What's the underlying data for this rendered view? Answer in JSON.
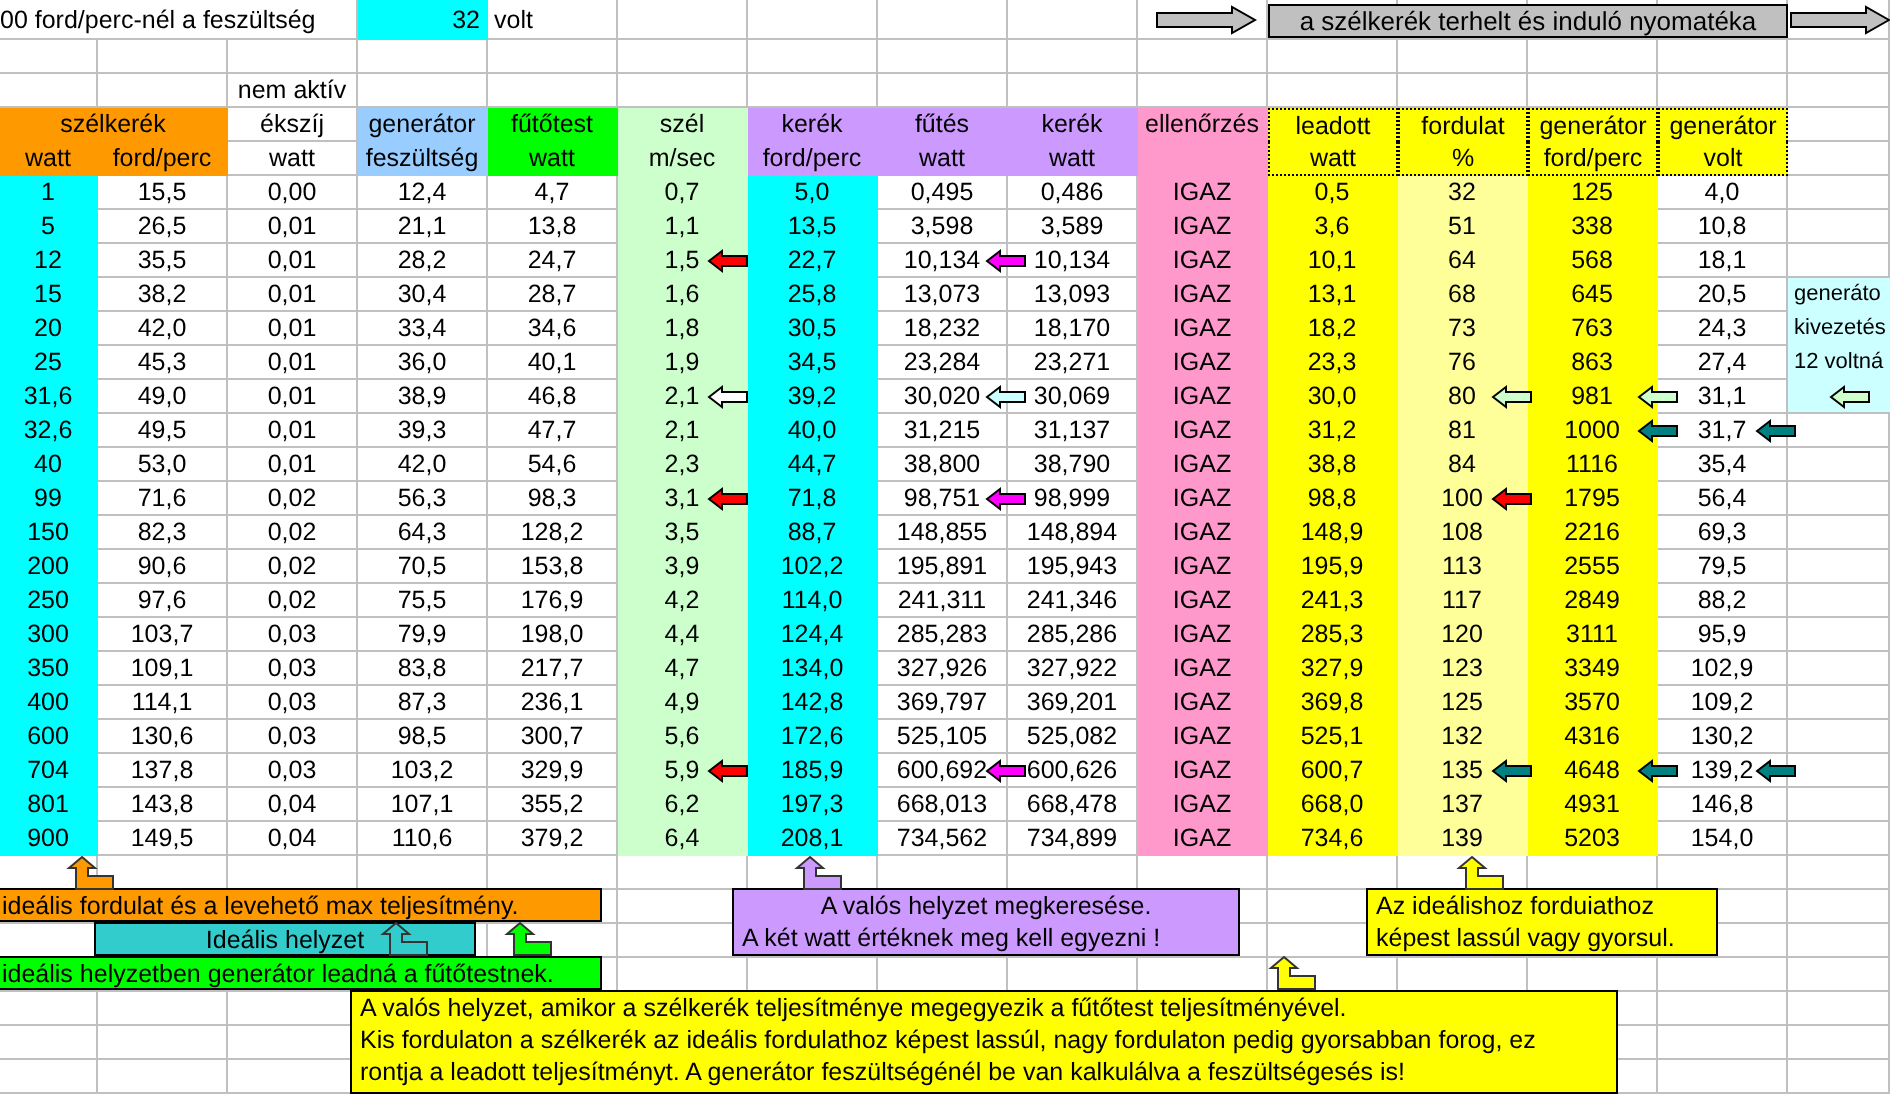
{
  "top": {
    "label": "00 ford/perc-nél a feszültség",
    "value": "32",
    "unit": "volt"
  },
  "banner": "a szélkerék terhelt és induló nyomatéka",
  "header_note": "nem aktív",
  "columns": [
    {
      "title": "szélkerék",
      "unit": "watt"
    },
    {
      "unit": "ford/perc"
    },
    {
      "title": "ékszíj",
      "unit": "watt"
    },
    {
      "title": "generátor",
      "unit": "feszültség"
    },
    {
      "title": "fűtőtest",
      "unit": "watt"
    },
    {
      "title": "szél",
      "unit": "m/sec"
    },
    {
      "title": "kerék",
      "unit": "ford/perc"
    },
    {
      "title": "fűtés",
      "unit": "watt"
    },
    {
      "title": "kerék",
      "unit": "watt"
    },
    {
      "title": "ellenőrzés"
    },
    {
      "title": "leadott",
      "unit": "watt",
      "framed": true
    },
    {
      "title": "fordulat",
      "unit": "%",
      "framed": true
    },
    {
      "title": "generátor",
      "unit": "ford/perc",
      "framed": true
    },
    {
      "title": "generátor",
      "unit": "volt",
      "framed": true
    }
  ],
  "rows": [
    {
      "cells": [
        "1",
        "15,5",
        "0,00",
        "12,4",
        "4,7",
        "0,7",
        "5,0",
        "0,495",
        "0,486",
        "IGAZ",
        "0,5",
        "32",
        "125",
        "4,0"
      ]
    },
    {
      "cells": [
        "5",
        "26,5",
        "0,01",
        "21,1",
        "13,8",
        "1,1",
        "13,5",
        "3,598",
        "3,589",
        "IGAZ",
        "3,6",
        "51",
        "338",
        "10,8"
      ]
    },
    {
      "cells": [
        "12",
        "35,5",
        "0,01",
        "28,2",
        "24,7",
        {
          "text": "1,5",
          "arrow": {
            "color": "#ff0000"
          }
        },
        "22,7",
        {
          "text": "10,134",
          "arrow": {
            "color": "#ff00ff"
          }
        },
        "10,134",
        "IGAZ",
        "10,1",
        "64",
        "568",
        "18,1"
      ]
    },
    {
      "cells": [
        "15",
        "38,2",
        "0,01",
        "30,4",
        "28,7",
        "1,6",
        "25,8",
        "13,073",
        "13,093",
        "IGAZ",
        "13,1",
        "68",
        "645",
        "20,5"
      ]
    },
    {
      "cells": [
        "20",
        "42,0",
        "0,01",
        "33,4",
        "34,6",
        "1,8",
        "30,5",
        "18,232",
        "18,170",
        "IGAZ",
        "18,2",
        "73",
        "763",
        "24,3"
      ]
    },
    {
      "cells": [
        "25",
        "45,3",
        "0,01",
        "36,0",
        "40,1",
        "1,9",
        "34,5",
        "23,284",
        "23,271",
        "IGAZ",
        "23,3",
        "76",
        "863",
        "27,4"
      ]
    },
    {
      "cells": [
        "31,6",
        "49,0",
        "0,01",
        "38,9",
        "46,8",
        {
          "text": "2,1",
          "arrow": {
            "color": "#ffffff"
          }
        },
        "39,2",
        {
          "text": "30,020",
          "arrow": {
            "color": "#ccffff"
          }
        },
        "30,069",
        "IGAZ",
        "30,0",
        {
          "text": "80",
          "arrow": {
            "color": "#ccffcc"
          }
        },
        {
          "text": "981",
          "arrow": {
            "color": "#ccffcc"
          }
        },
        "31,1"
      ]
    },
    {
      "cells": [
        "32,6",
        "49,5",
        "0,01",
        "39,3",
        "47,7",
        "2,1",
        "40,0",
        "31,215",
        "31,137",
        "IGAZ",
        "31,2",
        "81",
        {
          "text": "1000",
          "arrow": {
            "color": "#008080"
          }
        },
        {
          "text": "31,7",
          "arrow": {
            "color": "#008080"
          }
        }
      ]
    },
    {
      "cells": [
        "40",
        "53,0",
        "0,01",
        "42,0",
        "54,6",
        "2,3",
        "44,7",
        "38,800",
        "38,790",
        "IGAZ",
        "38,8",
        "84",
        "1116",
        "35,4"
      ]
    },
    {
      "cells": [
        "99",
        "71,6",
        "0,02",
        "56,3",
        "98,3",
        {
          "text": "3,1",
          "arrow": {
            "color": "#ff0000"
          }
        },
        "71,8",
        {
          "text": "98,751",
          "arrow": {
            "color": "#ff00ff"
          }
        },
        "98,999",
        "IGAZ",
        "98,8",
        {
          "text": "100",
          "arrow": {
            "color": "#ff0000"
          }
        },
        "1795",
        "56,4"
      ]
    },
    {
      "cells": [
        "150",
        "82,3",
        "0,02",
        "64,3",
        "128,2",
        "3,5",
        "88,7",
        "148,855",
        "148,894",
        "IGAZ",
        "148,9",
        "108",
        "2216",
        "69,3"
      ]
    },
    {
      "cells": [
        "200",
        "90,6",
        "0,02",
        "70,5",
        "153,8",
        "3,9",
        "102,2",
        "195,891",
        "195,943",
        "IGAZ",
        "195,9",
        "113",
        "2555",
        "79,5"
      ]
    },
    {
      "cells": [
        "250",
        "97,6",
        "0,02",
        "75,5",
        "176,9",
        "4,2",
        "114,0",
        "241,311",
        "241,346",
        "IGAZ",
        "241,3",
        "117",
        "2849",
        "88,2"
      ]
    },
    {
      "cells": [
        "300",
        "103,7",
        "0,03",
        "79,9",
        "198,0",
        "4,4",
        "124,4",
        "285,283",
        "285,286",
        "IGAZ",
        "285,3",
        "120",
        "3111",
        "95,9"
      ]
    },
    {
      "cells": [
        "350",
        "109,1",
        "0,03",
        "83,8",
        "217,7",
        "4,7",
        "134,0",
        "327,926",
        "327,922",
        "IGAZ",
        "327,9",
        "123",
        "3349",
        "102,9"
      ]
    },
    {
      "cells": [
        "400",
        "114,1",
        "0,03",
        "87,3",
        "236,1",
        "4,9",
        "142,8",
        "369,797",
        "369,201",
        "IGAZ",
        "369,8",
        "125",
        "3570",
        "109,2"
      ]
    },
    {
      "cells": [
        "600",
        "130,6",
        "0,03",
        "98,5",
        "300,7",
        "5,6",
        "172,6",
        "525,105",
        "525,082",
        "IGAZ",
        "525,1",
        "132",
        "4316",
        "130,2"
      ]
    },
    {
      "cells": [
        "704",
        "137,8",
        "0,03",
        "103,2",
        "329,9",
        {
          "text": "5,9",
          "arrow": {
            "color": "#ff0000"
          }
        },
        "185,9",
        {
          "text": "600,692",
          "arrow": {
            "color": "#ff00ff"
          }
        },
        "600,626",
        "IGAZ",
        "600,7",
        {
          "text": "135",
          "arrow": {
            "color": "#008080"
          }
        },
        {
          "text": "4648",
          "arrow": {
            "color": "#008080"
          }
        },
        {
          "text": "139,2",
          "arrow": {
            "color": "#008080"
          }
        }
      ]
    },
    {
      "cells": [
        "801",
        "143,8",
        "0,04",
        "107,1",
        "355,2",
        "6,2",
        "197,3",
        "668,013",
        "668,478",
        "IGAZ",
        "668,0",
        "137",
        "4931",
        "146,8"
      ]
    },
    {
      "cells": [
        "900",
        "149,5",
        "0,04",
        "110,6",
        "379,2",
        "6,4",
        "208,1",
        "734,562",
        "734,899",
        "IGAZ",
        "734,6",
        "139",
        "5203",
        "154,0"
      ]
    }
  ],
  "side_note": {
    "lines": [
      "generáto",
      "kivezetés",
      "12 voltná"
    ],
    "arrow": {
      "color": "#ccffcc"
    }
  },
  "callouts": [
    {
      "lines": [
        "ideális fordulat és a levehető max teljesítmény."
      ],
      "color": "#ff9900"
    },
    {
      "lines": [
        "Ideális helyzet"
      ],
      "color": "#33cccc"
    },
    {
      "lines": [
        "ideális helyzetben generátor leadná a fűtőtestnek."
      ],
      "color": "#00ff00"
    },
    {
      "lines": [
        "A valós helyzet megkeresése.",
        "A két watt értéknek meg kell egyezni !"
      ],
      "color": "#cc99ff"
    },
    {
      "lines": [
        "Az ideálishoz forduiathoz",
        "képest lassúl vagy gyorsul."
      ],
      "color": "#ffff00"
    },
    {
      "lines": [
        "A valós helyzet, amikor a szélkerék teljesítménye megegyezik a fűtőtest teljesítményével.",
        "Kis fordulaton a szélkerék az ideális fordulathoz képest lassúl, nagy fordulaton pedig gyorsabban forog, ez",
        "rontja a leadott teljesítményt. A generátor feszültségénél be van kalkulálva a feszültségesés is!"
      ],
      "color": "#ffff00"
    }
  ]
}
